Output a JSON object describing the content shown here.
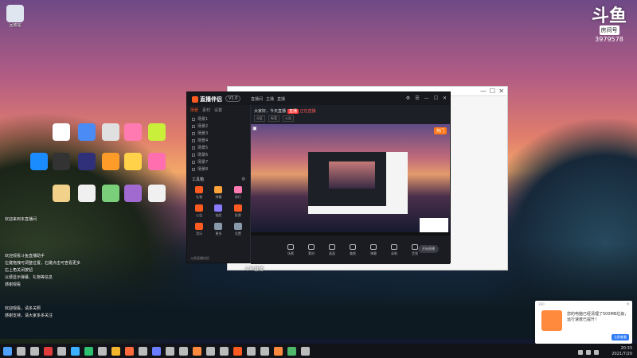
{
  "watermark": {
    "logo": "斗鱼",
    "tag": "房间号",
    "room_number": "3979578"
  },
  "desktop_icons": [
    {
      "id": "recycle",
      "label": "回收站",
      "color": "#dfe6ef"
    },
    {
      "id": "r1",
      "label": "",
      "color": "#ffffff"
    },
    {
      "id": "r2",
      "label": "",
      "color": "#4b8bf5"
    },
    {
      "id": "r3",
      "label": "",
      "color": "#e0e0e0"
    },
    {
      "id": "r4",
      "label": "",
      "color": "#ff7ab0"
    },
    {
      "id": "r5",
      "label": "",
      "color": "#c9ef3a"
    },
    {
      "id": "r6",
      "label": "",
      "color": "#1a8cff"
    },
    {
      "id": "r7",
      "label": "",
      "color": "#333333"
    },
    {
      "id": "r8",
      "label": "",
      "color": "#2f2f7a"
    },
    {
      "id": "r9",
      "label": "",
      "color": "#ff9c29"
    },
    {
      "id": "r10",
      "label": "",
      "color": "#ffd24a"
    },
    {
      "id": "r11",
      "label": "",
      "color": "#ff6fb0"
    },
    {
      "id": "r12",
      "label": "",
      "color": "#f2d28a"
    },
    {
      "id": "r13",
      "label": "",
      "color": "#f0f0f0"
    },
    {
      "id": "r14",
      "label": "",
      "color": "#7ad07a"
    },
    {
      "id": "r15",
      "label": "",
      "color": "#a06ad0"
    },
    {
      "id": "r16",
      "label": "",
      "color": "#f0f0f0"
    }
  ],
  "chat_top": [
    "欢迎来到本直播间"
  ],
  "chat_mid": [
    "欢迎观看斗鱼直播助手",
    "左键拖拽可调整位置，右键点击可查看更多",
    "右上角关闭按钮",
    "以便显示弹幕、礼物等信息",
    "感谢观看"
  ],
  "chat_bottom": [
    "欢迎观看，请多关照",
    "感谢支持，请大家多多关注"
  ],
  "app": {
    "logo": "直播伴侣",
    "version": "V1.0",
    "tabs": [
      "直播间",
      "主播",
      "直播"
    ],
    "stream_title": "大家好，今天直播",
    "live_tag": "直播",
    "live_status": "正在直播",
    "meta": [
      "分区",
      "标签",
      "公告"
    ],
    "side_tabs": [
      "场景",
      "素材",
      "设置"
    ],
    "scenes": [
      "场景1",
      "场景2",
      "场景3",
      "场景4",
      "场景5",
      "场景6",
      "场景7",
      "场景8"
    ],
    "tools_title": "工具箱",
    "tools": [
      {
        "label": "礼物",
        "color": "#ff5a1f"
      },
      {
        "label": "弹幕",
        "color": "#ffa23a"
      },
      {
        "label": "排行",
        "color": "#ff7ab0"
      },
      {
        "label": "公告",
        "color": "#ff5a1f"
      },
      {
        "label": "抽奖",
        "color": "#8a7cff"
      },
      {
        "label": "投票",
        "color": "#ff5a1f"
      },
      {
        "label": "音乐",
        "color": "#ff5a1f"
      },
      {
        "label": "更多",
        "color": "#8899aa"
      },
      {
        "label": "设置",
        "color": "#8899aa"
      }
    ],
    "side_footer": "斗鱼直播伴侣",
    "hot_badge": "热门",
    "bottom_buttons": [
      "场景",
      "素材",
      "画面",
      "美颜",
      "弹幕",
      "录制",
      "音频"
    ],
    "start_label": "开始直播"
  },
  "caption_under": "斗鱼直播",
  "notification": {
    "header": "360",
    "text": "您的电脑已经清理了500MB垃圾，运行速度已提升！",
    "button": "立即查看"
  },
  "tray": {
    "time": "20:33",
    "date": "2021/7/20"
  }
}
